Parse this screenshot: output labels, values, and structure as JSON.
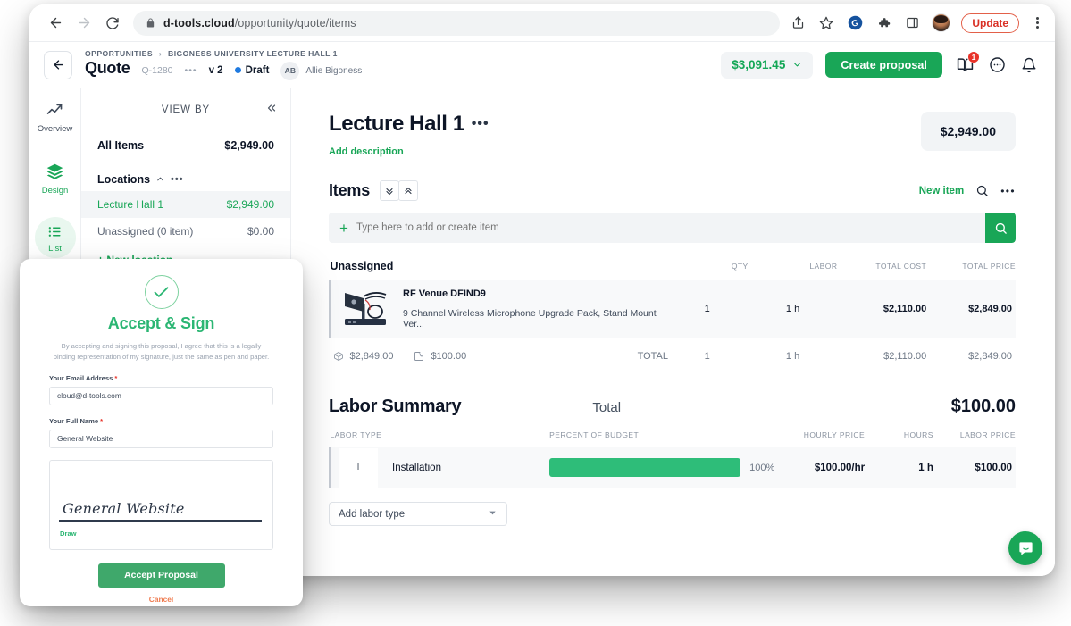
{
  "browser": {
    "url_bold": "d-tools.cloud",
    "url_rest": "/opportunity/quote/items",
    "update_label": "Update",
    "icons": {
      "back": "back-arrow-icon",
      "forward": "forward-arrow-icon",
      "reload": "reload-icon",
      "lock": "lock-icon",
      "share": "share-icon",
      "bookmark": "star-icon",
      "ext_grammarly": "grammarly-icon",
      "ext_puzzle": "extensions-puzzle-icon",
      "sidepanel": "side-panel-icon",
      "profile": "profile-avatar",
      "menu": "browser-menu-icon"
    }
  },
  "header": {
    "back_icon": "back-arrow-icon",
    "breadcrumb_root": "OPPORTUNITIES",
    "breadcrumb_sep": "›",
    "breadcrumb_current": "BIGONESS UNIVERSITY LECTURE HALL 1",
    "title": "Quote",
    "quote_number": "Q-1280",
    "dots": "•••",
    "version": "v 2",
    "status": "Draft",
    "status_color": "#1f7ae0",
    "owner_initials": "AB",
    "owner_name": "Allie Bigoness",
    "total_amount": "$3,091.45",
    "create_proposal_label": "Create proposal",
    "notification_badge": "1"
  },
  "rail": {
    "items": [
      {
        "label": "Overview",
        "icon": "trend-up-icon",
        "active": false
      },
      {
        "label": "Design",
        "icon": "layers-icon",
        "active": true
      },
      {
        "label": "List",
        "icon": "list-icon",
        "active": true
      }
    ]
  },
  "viewby": {
    "heading": "VIEW BY",
    "collapse_icon": "double-chevron-left-icon",
    "all_items_label": "All Items",
    "all_items_value": "$2,949.00",
    "group_label": "Locations",
    "group_caret": "caret-up-icon",
    "group_dots": "•••",
    "locations": [
      {
        "label": "Lecture Hall 1",
        "value": "$2,949.00",
        "active": true
      },
      {
        "label": "Unassigned (0 item)",
        "value": "$0.00",
        "active": false
      }
    ],
    "new_location_label": "+ New location"
  },
  "main": {
    "location_title": "Lecture Hall 1",
    "location_dots": "•••",
    "add_description": "Add description",
    "price_box": "$2,949.00",
    "items_heading": "Items",
    "collapse_all_icon": "chevrons-down-icon",
    "expand_all_icon": "chevrons-up-icon",
    "new_item_label": "New item",
    "search_icon": "search-icon",
    "more_dots": "•••",
    "add_placeholder": "Type here to add or create item",
    "add_plus": "+",
    "search_button_icon": "search-icon",
    "table": {
      "group_label": "Unassigned",
      "columns": [
        "QTY",
        "LABOR",
        "TOTAL COST",
        "TOTAL PRICE"
      ],
      "rows": [
        {
          "name": "RF Venue DFIND9",
          "description": "9 Channel Wireless Microphone Upgrade Pack, Stand Mount Ver...",
          "qty": "1",
          "labor": "1 h",
          "total_cost": "$2,110.00",
          "total_price": "$2,849.00"
        }
      ],
      "totals": {
        "box_icon": "box-icon",
        "box_value": "$2,849.00",
        "wrench_icon": "wrench-icon",
        "wrench_value": "$100.00",
        "label": "TOTAL",
        "qty": "1",
        "labor": "1 h",
        "total_cost": "$2,110.00",
        "total_price": "$2,849.00"
      }
    },
    "labor": {
      "heading": "Labor Summary",
      "total_label": "Total",
      "total_value": "$100.00",
      "columns": [
        "LABOR TYPE",
        "PERCENT OF BUDGET",
        "HOURLY PRICE",
        "HOURS",
        "LABOR PRICE"
      ],
      "rows": [
        {
          "badge": "I",
          "name": "Installation",
          "percent": 100,
          "percent_label": "100%",
          "hourly_price": "$100.00/hr",
          "hours": "1 h",
          "labor_price": "$100.00"
        }
      ],
      "add_labor_label": "Add labor type",
      "add_labor_caret": "chevron-down-icon"
    },
    "intercom_icon": "chat-bubble-icon"
  },
  "modal": {
    "check_icon": "check-icon",
    "title": "Accept & Sign",
    "disclaimer": "By accepting and signing this proposal, I agree that this is a legally binding representation of my signature, just the same as pen and paper.",
    "email_label": "Your Email Address",
    "email_required": "*",
    "email_value": "cloud@d-tools.com",
    "name_label": "Your Full Name",
    "name_required": "*",
    "name_value": "General Website",
    "signature_text": "General Website",
    "draw_label": "Draw",
    "accept_label": "Accept Proposal",
    "cancel_label": "Cancel"
  },
  "colors": {
    "green": "#19a657",
    "bar_green": "#2ebd79",
    "modal_green": "#2bb673",
    "blue_dot": "#1f7ae0",
    "red_badge": "#e8332a",
    "orange_cancel": "#ef7d52"
  }
}
